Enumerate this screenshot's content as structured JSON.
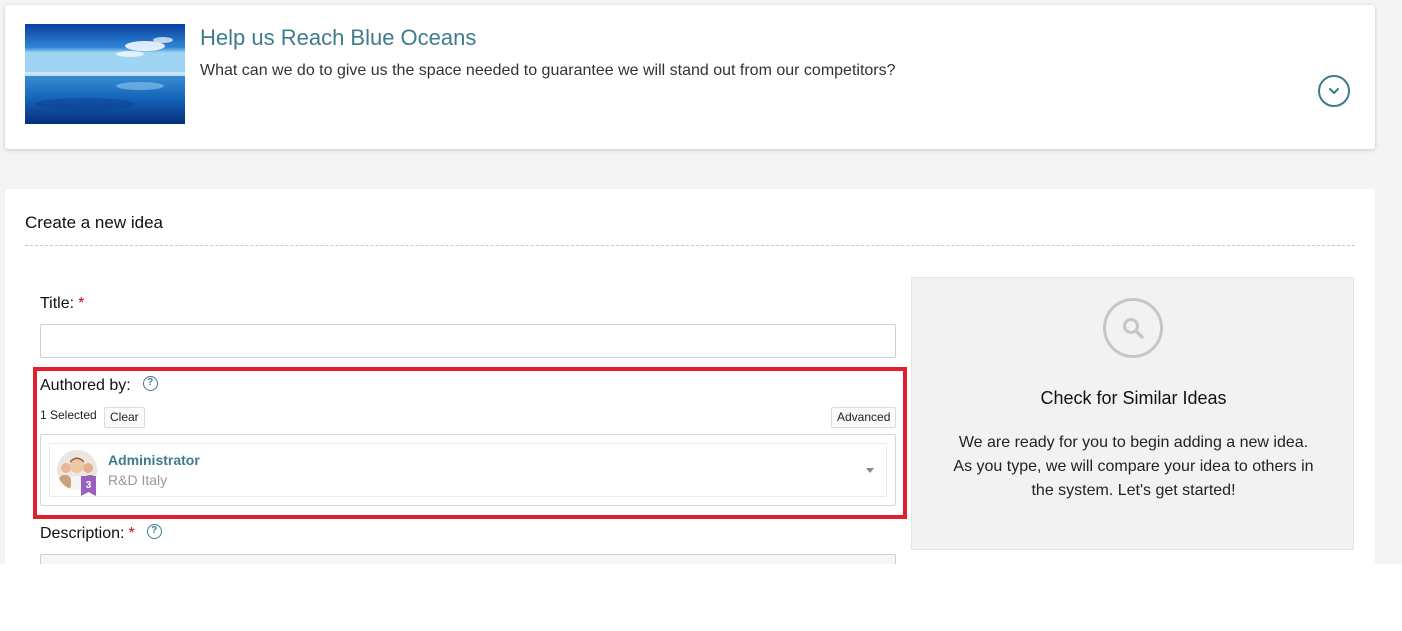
{
  "challenge": {
    "title": "Help us Reach Blue Oceans",
    "description": "What can we do to give us the space needed to guarantee we will stand out from our competitors?"
  },
  "form": {
    "heading": "Create a new idea",
    "title_label": "Title:",
    "required_marker": "*",
    "title_value": "",
    "authored_by_label": "Authored by:",
    "help_glyph": "?",
    "selected_count": "1 Selected",
    "clear_label": "Clear",
    "advanced_label": "Advanced",
    "author": {
      "name": "Administrator",
      "department": "R&D Italy",
      "rank": "3"
    },
    "description_label": "Description:"
  },
  "similar_ideas": {
    "title": "Check for Similar Ideas",
    "lines": [
      "We are ready for you to begin adding a new idea.",
      "As you type, we will compare your idea to others in",
      "the system. Let's get started!"
    ]
  },
  "colors": {
    "accent": "#3e7b8c",
    "required": "#d0021b",
    "highlight": "#e0202e",
    "badge": "#9b5fc0"
  },
  "icons": [
    "chevron-down-icon",
    "help-icon",
    "search-icon",
    "caret-down-icon",
    "rank-badge-icon"
  ]
}
